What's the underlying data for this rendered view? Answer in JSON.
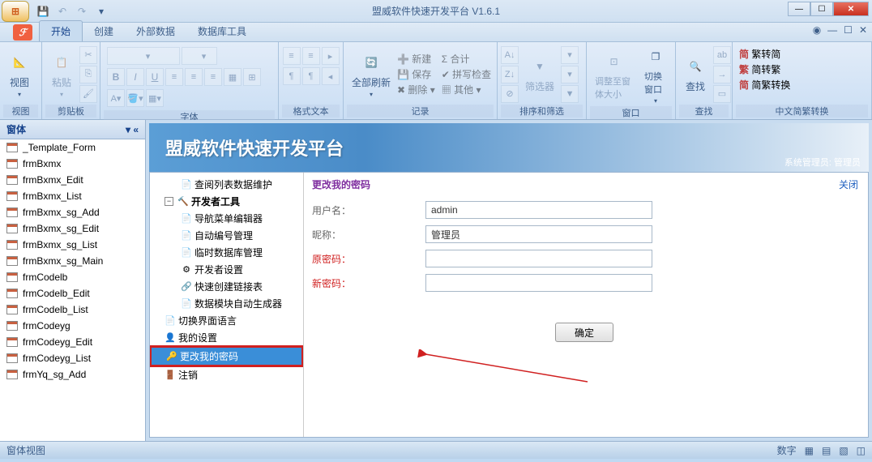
{
  "window": {
    "title": "盟威软件快速开发平台  V1.6.1"
  },
  "qat": {
    "save": "💾"
  },
  "tabs": [
    "开始",
    "创建",
    "外部数据",
    "数据库工具"
  ],
  "ribbon": {
    "view": {
      "label": "视图",
      "group": "视图"
    },
    "clipboard": {
      "paste": "粘贴",
      "group": "剪贴板"
    },
    "font": {
      "group": "字体"
    },
    "richtext": {
      "group": "格式文本"
    },
    "records": {
      "refresh": "全部刷新",
      "new": "新建",
      "save": "保存",
      "delete": "删除",
      "sum": "合计",
      "spell": "拼写检查",
      "more": "其他",
      "group": "记录"
    },
    "sortfilter": {
      "filter": "筛选器",
      "group": "排序和筛选"
    },
    "window_grp": {
      "fit": "调整至窗体大小",
      "switch": "切换窗口",
      "group": "窗口"
    },
    "find": {
      "find": "查找",
      "group": "查找"
    },
    "chinese": {
      "a": "繁转简",
      "b": "简转繁",
      "c": "简繁转换",
      "group": "中文简繁转换"
    }
  },
  "nav": {
    "header": "窗体",
    "items": [
      "_Template_Form",
      "frmBxmx",
      "frmBxmx_Edit",
      "frmBxmx_List",
      "frmBxmx_sg_Add",
      "frmBxmx_sg_Edit",
      "frmBxmx_sg_List",
      "frmBxmx_sg_Main",
      "frmCodelb",
      "frmCodelb_Edit",
      "frmCodelb_List",
      "frmCodeyg",
      "frmCodeyg_Edit",
      "frmCodeyg_List",
      "frmYq_sg_Add"
    ]
  },
  "banner": {
    "title": "盟威软件快速开发平台",
    "sub": "系统管理员: 管理员"
  },
  "tree": {
    "n0": "查阅列表数据维护",
    "n1": "开发者工具",
    "n1_1": "导航菜单编辑器",
    "n1_2": "自动编号管理",
    "n1_3": "临时数据库管理",
    "n1_4": "开发者设置",
    "n1_5": "快速创建链接表",
    "n1_6": "数据模块自动生成器",
    "n2": "切换界面语言",
    "n3": "我的设置",
    "n4": "更改我的密码",
    "n5": "注销"
  },
  "form": {
    "title": "更改我的密码",
    "close": "关闭",
    "username_label": "用户名：",
    "username_value": "admin",
    "nickname_label": "昵称：",
    "nickname_value": "管理员",
    "oldpwd_label": "原密码：",
    "newpwd_label": "新密码：",
    "submit": "确定"
  },
  "statusbar": {
    "left": "窗体视图",
    "num": "数字"
  }
}
